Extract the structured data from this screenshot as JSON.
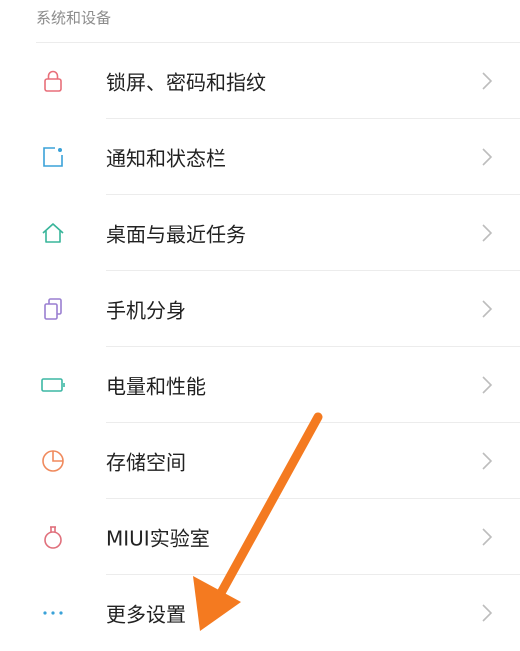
{
  "section": {
    "title": "系统和设备"
  },
  "items": [
    {
      "label": "锁屏、密码和指纹",
      "icon": "lock-icon",
      "color": "#e86f7a"
    },
    {
      "label": "通知和状态栏",
      "icon": "notification-icon",
      "color": "#3aa2d8"
    },
    {
      "label": "桌面与最近任务",
      "icon": "home-icon",
      "color": "#38b59a"
    },
    {
      "label": "手机分身",
      "icon": "dual-phone-icon",
      "color": "#9a7fd1"
    },
    {
      "label": "电量和性能",
      "icon": "battery-icon",
      "color": "#3cb7a4"
    },
    {
      "label": "存储空间",
      "icon": "storage-pie-icon",
      "color": "#f08a5d"
    },
    {
      "label": "MIUI实验室",
      "icon": "flask-icon",
      "color": "#e0707c"
    },
    {
      "label": "更多设置",
      "icon": "more-dots-icon",
      "color": "#3aa2d8"
    }
  ],
  "annotation": {
    "arrow_color": "#f47a20"
  }
}
